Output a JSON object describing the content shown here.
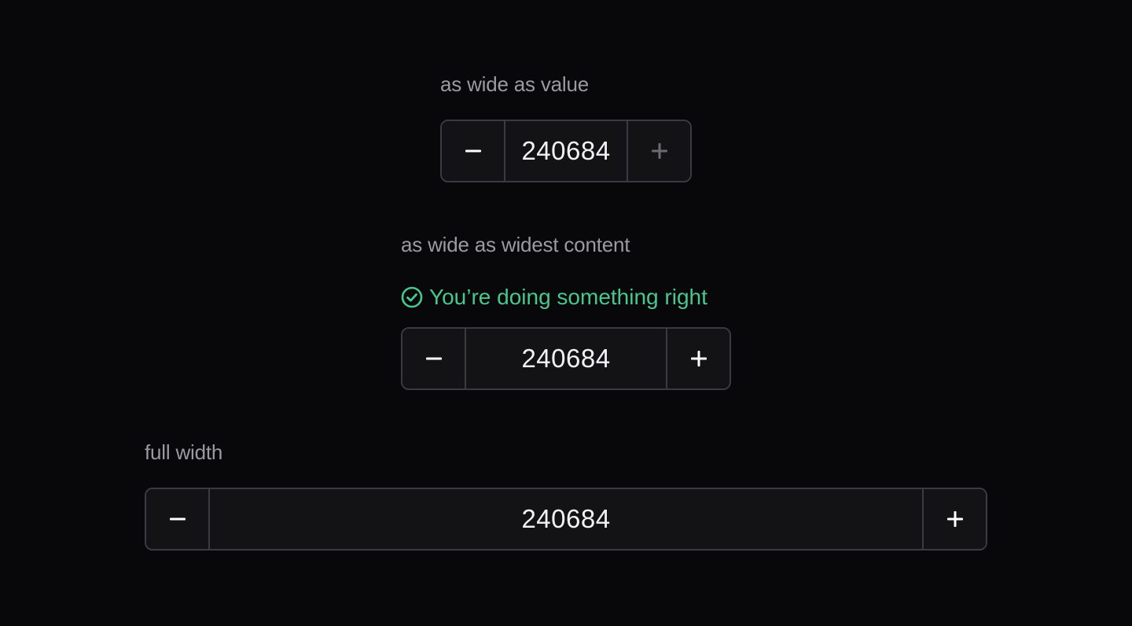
{
  "sections": [
    {
      "label": "as wide as value",
      "value": "240684",
      "decrement_icon": "minus-icon",
      "increment_icon": "plus-icon",
      "increment_disabled": true
    },
    {
      "label": "as wide as widest content",
      "status_icon": "check-circle-icon",
      "status_text": "You’re doing something right",
      "value": "240684",
      "decrement_icon": "minus-icon",
      "increment_icon": "plus-icon",
      "increment_disabled": false
    },
    {
      "label": "full width",
      "value": "240684",
      "decrement_icon": "minus-icon",
      "increment_icon": "plus-icon",
      "increment_disabled": false
    }
  ],
  "colors": {
    "background": "#08080a",
    "label": "#9a9aa1",
    "border": "#3a3a3f",
    "field": "#131316",
    "value_text": "#f2f2f5",
    "icon": "#ffffff",
    "icon_disabled": "#6b6b71",
    "success": "#48c78e"
  }
}
